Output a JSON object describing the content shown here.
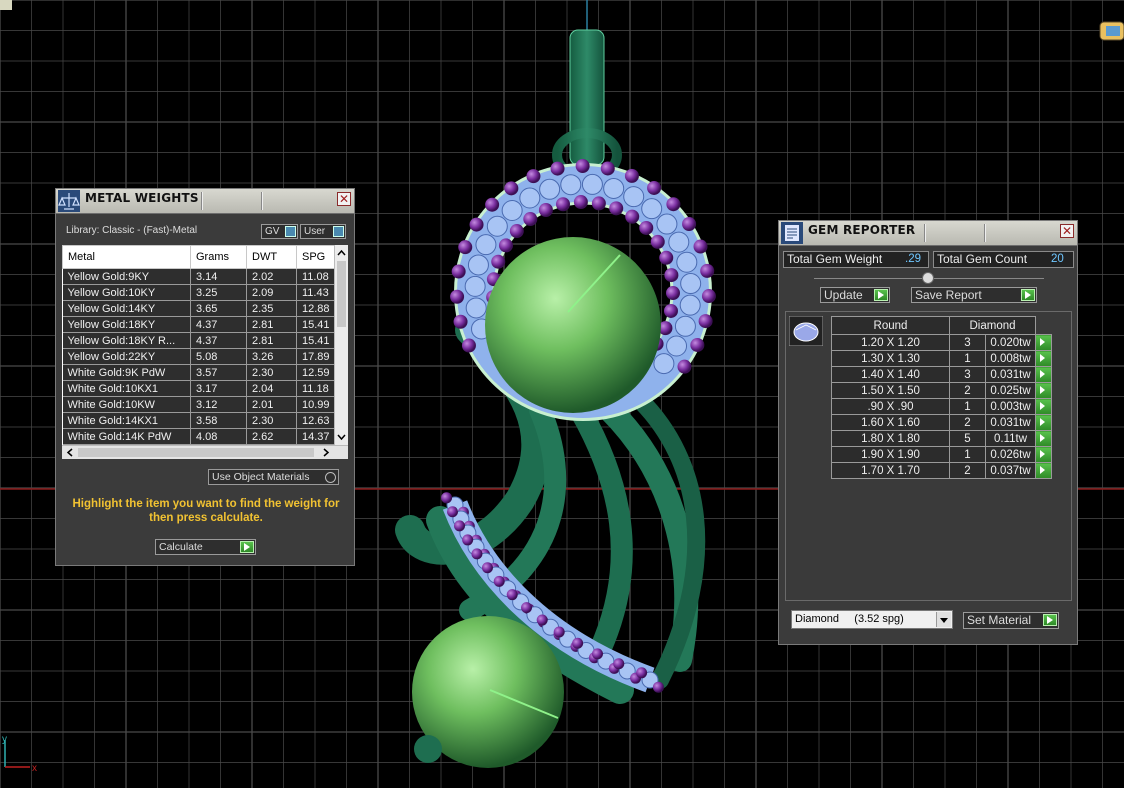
{
  "metal_weights": {
    "title": "METAL WEIGHTS",
    "library": "Library: Classic - (Fast)-Metal",
    "gv_label": "GV",
    "user_label": "User",
    "columns": [
      "Metal",
      "Grams",
      "DWT",
      "SPG"
    ],
    "rows": [
      [
        "Yellow Gold:9KY",
        "3.14",
        "2.02",
        "11.08"
      ],
      [
        "Yellow Gold:10KY",
        "3.25",
        "2.09",
        "11.43"
      ],
      [
        "Yellow Gold:14KY",
        "3.65",
        "2.35",
        "12.88"
      ],
      [
        "Yellow Gold:18KY",
        "4.37",
        "2.81",
        "15.41"
      ],
      [
        "Yellow Gold:18KY R...",
        "4.37",
        "2.81",
        "15.41"
      ],
      [
        "Yellow Gold:22KY",
        "5.08",
        "3.26",
        "17.89"
      ],
      [
        "White Gold:9K PdW",
        "3.57",
        "2.30",
        "12.59"
      ],
      [
        "White Gold:10KX1",
        "3.17",
        "2.04",
        "11.18"
      ],
      [
        "White Gold:10KW",
        "3.12",
        "2.01",
        "10.99"
      ],
      [
        "White Gold:14KX1",
        "3.58",
        "2.30",
        "12.63"
      ],
      [
        "White Gold:14K PdW",
        "4.08",
        "2.62",
        "14.37"
      ]
    ],
    "use_object_materials": "Use Object Materials",
    "hint": "Highlight the item you want to find the weight for then press calculate.",
    "calculate": "Calculate"
  },
  "gem_reporter": {
    "title": "GEM REPORTER",
    "total_weight_label": "Total Gem Weight",
    "total_weight_value": ".29",
    "total_count_label": "Total Gem Count",
    "total_count_value": "20",
    "update": "Update",
    "save_report": "Save Report",
    "shape_header": "Round",
    "material_header": "Diamond",
    "rows": [
      [
        "1.20 X 1.20",
        "3",
        "0.020tw"
      ],
      [
        "1.30 X 1.30",
        "1",
        "0.008tw"
      ],
      [
        "1.40 X 1.40",
        "3",
        "0.031tw"
      ],
      [
        "1.50 X 1.50",
        "2",
        "0.025tw"
      ],
      [
        ".90 X .90",
        "1",
        "0.003tw"
      ],
      [
        "1.60 X 1.60",
        "2",
        "0.031tw"
      ],
      [
        "1.80 X 1.80",
        "5",
        "0.11tw"
      ],
      [
        "1.90 X 1.90",
        "1",
        "0.026tw"
      ],
      [
        "1.70 X 1.70",
        "2",
        "0.037tw"
      ]
    ],
    "material_select": "Diamond     (3.52 spg)",
    "set_material": "Set Material"
  },
  "viewport": {
    "axis_x": "x",
    "axis_y": "y"
  },
  "colors": {
    "metal": "#2e8a68",
    "sphere": "#6fbf5f",
    "gem_blue": "#8fb2ec",
    "gem_purple": "#7a2fa0",
    "grid": "#4a4a4a",
    "hint_text": "#f1c232",
    "value_text": "#6ec6ff"
  }
}
